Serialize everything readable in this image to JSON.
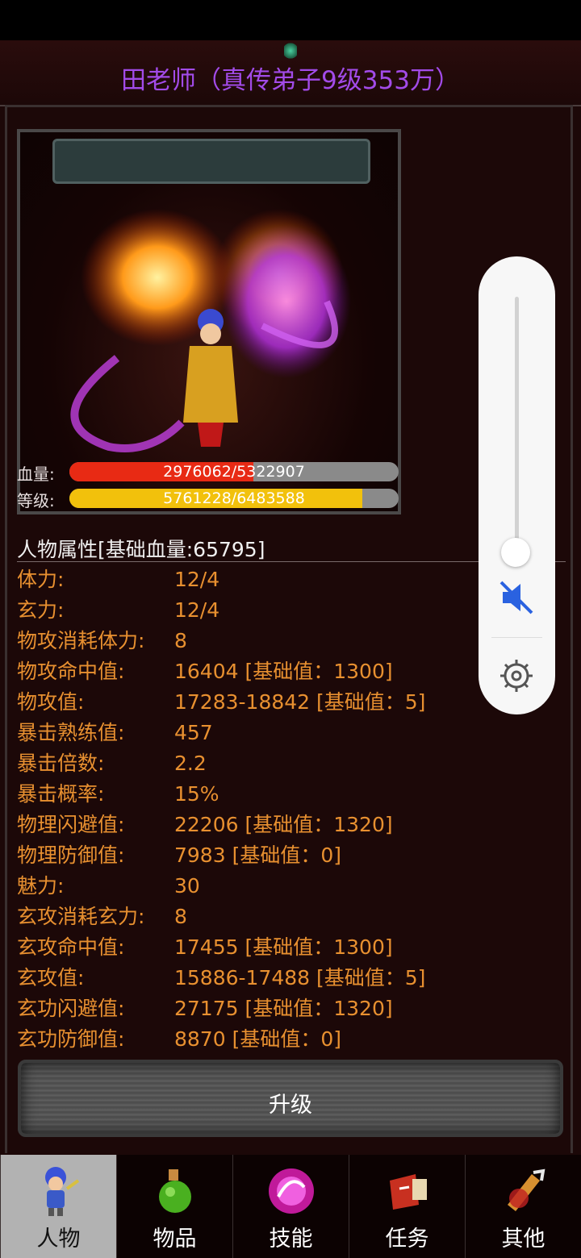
{
  "header": {
    "title": "田老师（真传弟子9级353万）"
  },
  "character": {
    "hp_label": "血量:",
    "hp_text": "2976062/5322907",
    "hp_fraction": 0.559,
    "level_label": "等级:",
    "exp_text": "5761228/6483588",
    "exp_fraction": 0.889,
    "hp_color": "#e82a14",
    "exp_color": "#f2c10c"
  },
  "attributes": {
    "header": "人物属性[基础血量:65795]",
    "items": [
      {
        "label": "体力:",
        "value": "12/4"
      },
      {
        "label": "玄力:",
        "value": "12/4"
      },
      {
        "label": "物攻消耗体力:",
        "value": "8"
      },
      {
        "label": "物攻命中值:",
        "value": "16404 [基础值：1300]"
      },
      {
        "label": "物攻值:",
        "value": "17283-18842 [基础值：5]"
      },
      {
        "label": "暴击熟练值:",
        "value": "457"
      },
      {
        "label": "暴击倍数:",
        "value": "2.2"
      },
      {
        "label": "暴击概率:",
        "value": "15%"
      },
      {
        "label": "物理闪避值:",
        "value": "22206 [基础值：1320]"
      },
      {
        "label": "物理防御值:",
        "value": "7983 [基础值：0]"
      },
      {
        "label": "魅力:",
        "value": "30"
      },
      {
        "label": "玄攻消耗玄力:",
        "value": "8"
      },
      {
        "label": "玄攻命中值:",
        "value": "17455 [基础值：1300]"
      },
      {
        "label": "玄攻值:",
        "value": "15886-17488 [基础值：5]"
      },
      {
        "label": "玄功闪避值:",
        "value": "27175 [基础值：1320]"
      },
      {
        "label": "玄功防御值:",
        "value": "8870 [基础值：0]"
      }
    ]
  },
  "upgrade_button": "升级",
  "tabs": [
    {
      "label": "人物",
      "icon": "character-icon",
      "active": true
    },
    {
      "label": "物品",
      "icon": "potion-icon",
      "active": false
    },
    {
      "label": "技能",
      "icon": "skill-orb-icon",
      "active": false
    },
    {
      "label": "任务",
      "icon": "quest-icon",
      "active": false
    },
    {
      "label": "其他",
      "icon": "other-icon",
      "active": false
    }
  ],
  "volume": {
    "level": 0.0,
    "muted": true,
    "icons": [
      "mute-icon",
      "gear-icon"
    ]
  },
  "colors": {
    "title": "#a24be8",
    "attribute_text": "#e89030",
    "background": "#1c0808"
  }
}
